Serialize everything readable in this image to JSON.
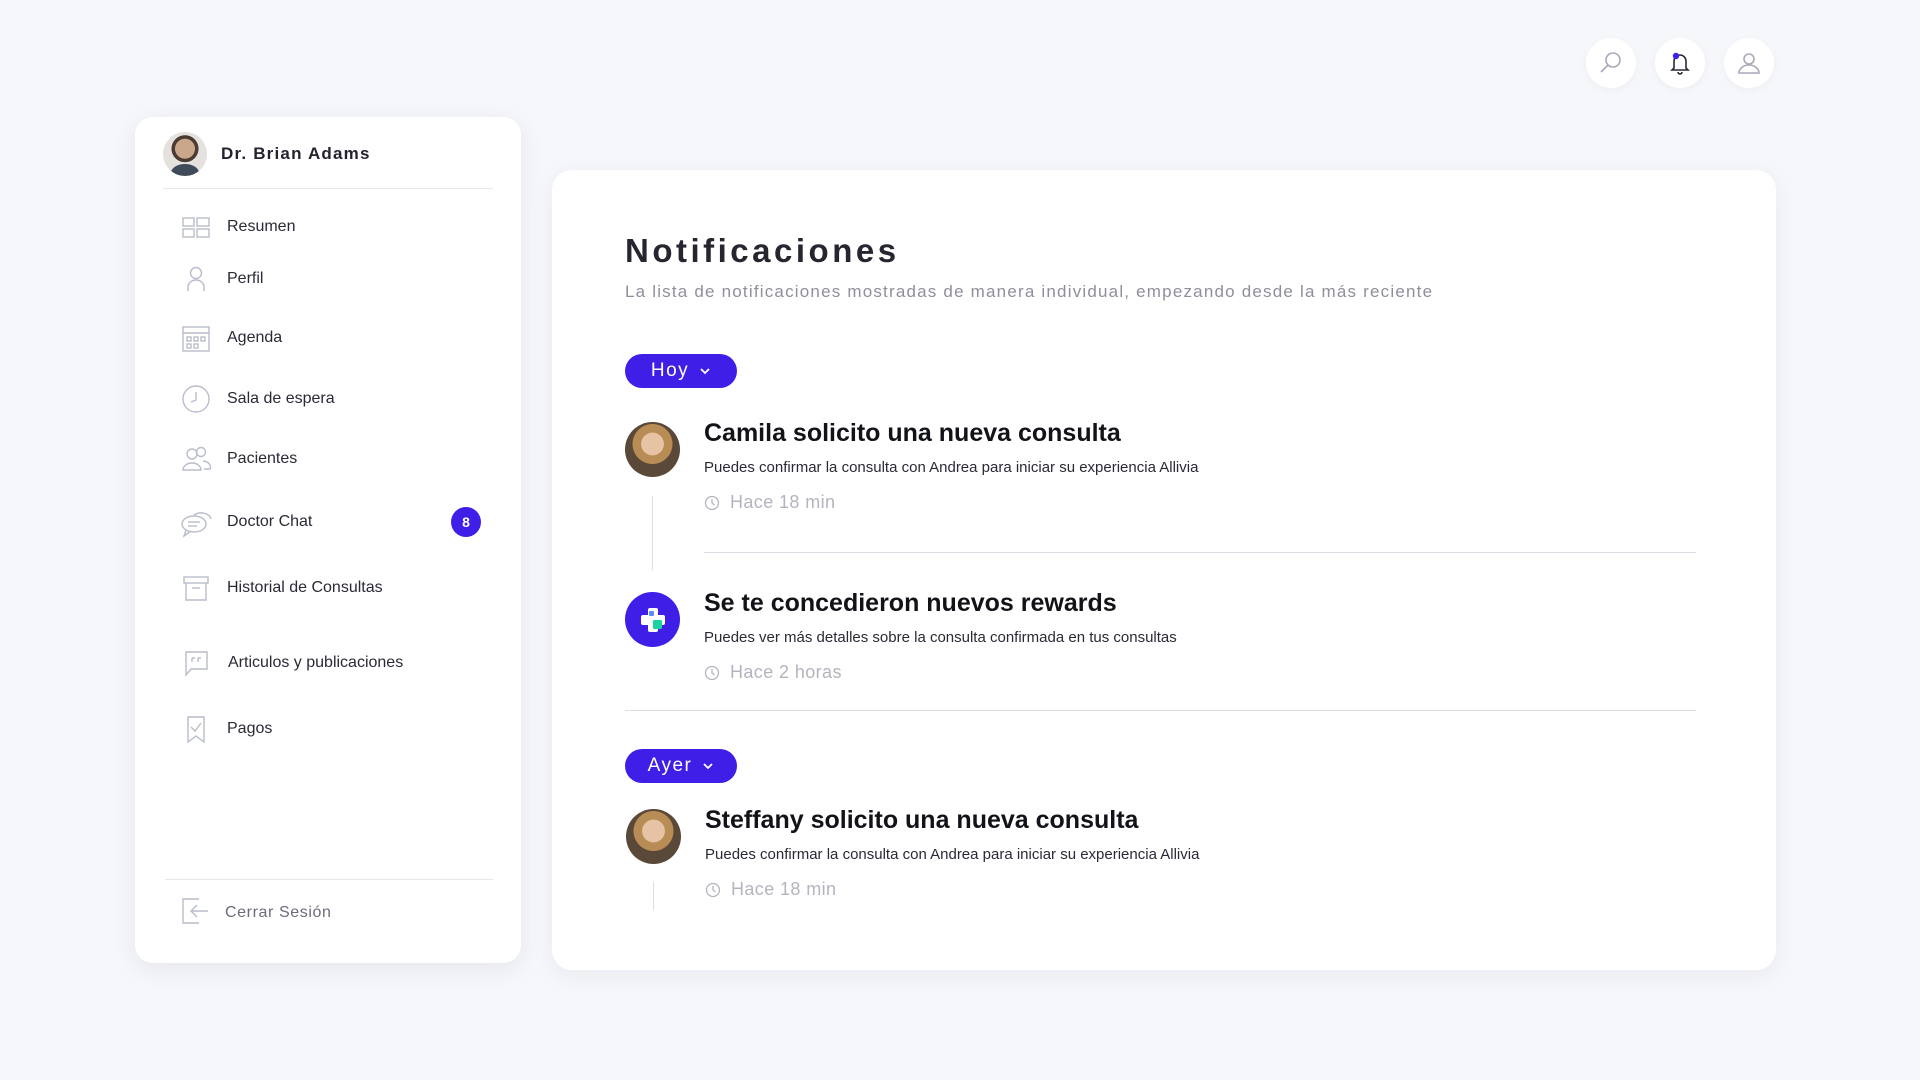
{
  "user": {
    "name": "Dr. Brian Adams"
  },
  "topbar": {
    "icons": [
      "search-icon",
      "bell-icon",
      "user-icon"
    ],
    "notification_dot_color": "#3f1ee8"
  },
  "sidebar": {
    "items": [
      {
        "label": "Resumen",
        "icon": "dashboard-icon"
      },
      {
        "label": "Perfil",
        "icon": "person-icon"
      },
      {
        "label": "Agenda",
        "icon": "calendar-icon"
      },
      {
        "label": "Sala de espera",
        "icon": "clock-icon"
      },
      {
        "label": "Pacientes",
        "icon": "users-icon"
      },
      {
        "label": "Doctor Chat",
        "icon": "chat-icon",
        "badge": "8"
      },
      {
        "label": "Historial de Consultas",
        "icon": "archive-icon"
      },
      {
        "label": "Articulos y publicaciones",
        "icon": "quote-icon"
      },
      {
        "label": "Pagos",
        "icon": "receipt-icon"
      }
    ],
    "logout_label": "Cerrar Sesión"
  },
  "main": {
    "title": "Notificaciones",
    "subtitle": "La lista de notificaciones mostradas de manera individual, empezando desde la más reciente",
    "groups": [
      {
        "label": "Hoy",
        "notifications": [
          {
            "title": "Camila solicito una nueva consulta",
            "description": "Puedes confirmar la consulta con Andrea para iniciar su experiencia Allivia",
            "time": "Hace 18 min"
          },
          {
            "title": "Se te concedieron nuevos rewards",
            "description": "Puedes ver más detalles sobre la consulta confirmada en tus consultas",
            "time": "Hace 2 horas"
          }
        ]
      },
      {
        "label": "Ayer",
        "notifications": [
          {
            "title": "Steffany solicito una nueva consulta",
            "description": "Puedes confirmar la consulta con Andrea para iniciar su experiencia Allivia",
            "time": "Hace 18 min"
          }
        ]
      }
    ]
  },
  "colors": {
    "accent": "#3f1ee8",
    "reward_cross_accent": "#19d3a2"
  }
}
